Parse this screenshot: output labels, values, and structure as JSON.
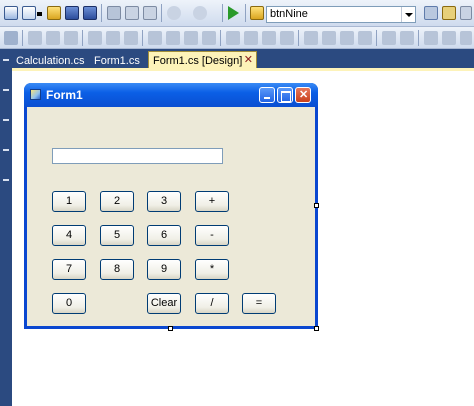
{
  "toolbar": {
    "combo_value": "btnNine"
  },
  "tabs": [
    {
      "label": "Calculation.cs",
      "active": false
    },
    {
      "label": "Form1.cs",
      "active": false
    },
    {
      "label": "Form1.cs [Design]",
      "active": true
    }
  ],
  "tab_close_glyph": "✕",
  "form": {
    "title": "Form1",
    "display_value": "",
    "buttons": {
      "btn1": "1",
      "btn2": "2",
      "btn3": "3",
      "btn_plus": "+",
      "btn4": "4",
      "btn5": "5",
      "btn6": "6",
      "btn_minus": "-",
      "btn7": "7",
      "btn8": "8",
      "btn9": "9",
      "btn_multiply": "*",
      "btn0": "0",
      "btn_clear": "Clear",
      "btn_divide": "/",
      "btn_equals": "="
    }
  },
  "colors": {
    "titlebar": "#0b5fe6",
    "form_client": "#ece9d8",
    "tab_strip": "#2b4a80",
    "active_tab": "#fdf3b9",
    "button_border": "#003c74"
  },
  "icons": [
    "new-project-icon",
    "add-item-icon",
    "open-icon",
    "save-icon",
    "save-all-icon",
    "cut-icon",
    "copy-icon",
    "paste-icon",
    "undo-icon",
    "redo-icon",
    "start-debug-icon",
    "find-in-files-icon",
    "solution-explorer-icon",
    "properties-icon",
    "toolbox-icon",
    "align-icons"
  ]
}
